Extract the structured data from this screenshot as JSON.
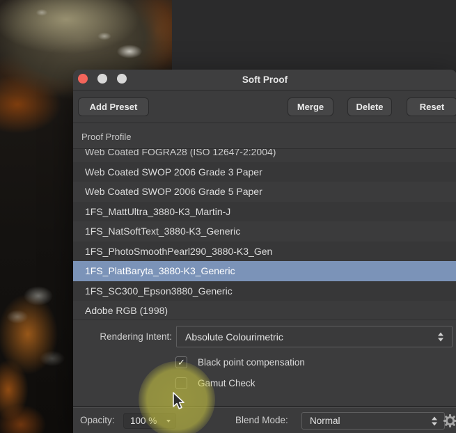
{
  "window": {
    "title": "Soft Proof"
  },
  "toolbar": {
    "add_preset": "Add Preset",
    "merge": "Merge",
    "delete": "Delete",
    "reset": "Reset"
  },
  "profile_section": {
    "label": "Proof Profile",
    "items": [
      {
        "label": "Web Coated FOGRA28 (ISO 12647-2:2004)",
        "selected": false,
        "clipped": true
      },
      {
        "label": "Web Coated SWOP 2006 Grade 3 Paper",
        "selected": false
      },
      {
        "label": "Web Coated SWOP 2006 Grade 5 Paper",
        "selected": false
      },
      {
        "label": "1FS_MattUltra_3880-K3_Martin-J",
        "selected": false
      },
      {
        "label": "1FS_NatSoftText_3880-K3_Generic",
        "selected": false
      },
      {
        "label": "1FS_PhotoSmoothPearl290_3880-K3_Gen",
        "selected": false
      },
      {
        "label": "1FS_PlatBaryta_3880-K3_Generic",
        "selected": true
      },
      {
        "label": "1FS_SC300_Epson3880_Generic",
        "selected": false
      },
      {
        "label": "Adobe RGB (1998)",
        "selected": false
      }
    ]
  },
  "intent": {
    "label": "Rendering Intent:",
    "value": "Absolute Colourimetric"
  },
  "options": [
    {
      "label": "Black point compensation",
      "checked": true
    },
    {
      "label": "Gamut Check",
      "checked": false
    }
  ],
  "footer": {
    "opacity_label": "Opacity:",
    "opacity_value": "100 %",
    "blend_label": "Blend Mode:",
    "blend_value": "Normal"
  },
  "icons": {
    "checkmark": "✓",
    "close": "red-circle",
    "minimize": "gray-circle",
    "zoom": "gray-circle",
    "dropdown_stepper": "up-down-triangles",
    "opacity_disclosure": "down-triangle",
    "gear": "gear-glyph"
  },
  "colors": {
    "panel": "#3c3c3d",
    "selection": "#7b93b8",
    "titlebar_close_red": "#f4655b",
    "click_highlight": "rgba(206,202,66,0.6)",
    "canvas_background": "#2b2b2c"
  }
}
